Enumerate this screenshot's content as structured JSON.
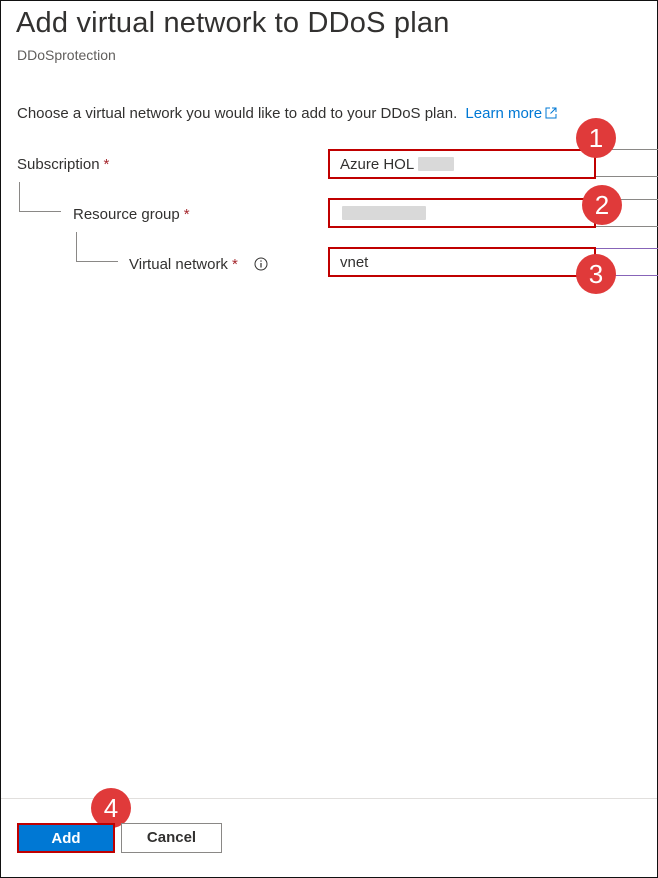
{
  "header": {
    "title": "Add virtual network to DDoS plan",
    "subtitle": "DDoSprotection"
  },
  "description": {
    "text": "Choose a virtual network you would like to add to your DDoS plan.",
    "link_label": "Learn more"
  },
  "form": {
    "subscription": {
      "label": "Subscription",
      "required_mark": "*",
      "value": "Azure HOL"
    },
    "resource_group": {
      "label": "Resource group",
      "required_mark": "*",
      "value": ""
    },
    "virtual_network": {
      "label": "Virtual network",
      "required_mark": "*",
      "value": "vnet"
    }
  },
  "annotations": [
    "1",
    "2",
    "3",
    "4"
  ],
  "footer": {
    "add_label": "Add",
    "cancel_label": "Cancel"
  },
  "colors": {
    "accent": "#0078d4",
    "required": "#a4262c",
    "highlight": "#c00000",
    "badge": "#e03a3a"
  },
  "icons": [
    "external-link-icon",
    "info-icon"
  ]
}
